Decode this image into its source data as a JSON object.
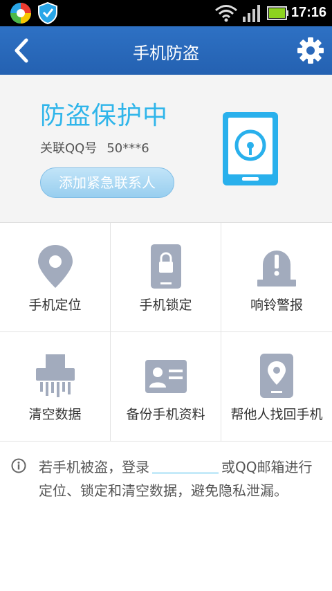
{
  "status_bar": {
    "time": "17:16",
    "icons": [
      "colorful-app-icon",
      "shield-app-icon",
      "wifi-icon",
      "signal-icon",
      "battery-icon"
    ],
    "battery_color": "#8dd21f"
  },
  "titlebar": {
    "title": "手机防盗",
    "back_icon": "back-arrow-icon",
    "settings_icon": "gear-icon",
    "color": "#2a68ba"
  },
  "hero": {
    "status_text": "防盗保护中",
    "qq_label": "关联QQ号",
    "qq_number": "50***6",
    "add_contact_button": "添加紧急联系人",
    "accent_color": "#2fb5ea"
  },
  "features": [
    {
      "label": "手机定位",
      "icon": "location-pin-icon"
    },
    {
      "label": "手机锁定",
      "icon": "phone-lock-icon"
    },
    {
      "label": "响铃警报",
      "icon": "alarm-bell-icon"
    },
    {
      "label": "清空数据",
      "icon": "shredder-icon"
    },
    {
      "label": "备份手机资料",
      "icon": "contact-card-icon"
    },
    {
      "label": "帮他人找回手机",
      "icon": "phone-location-icon"
    }
  ],
  "info": {
    "icon": "info-icon",
    "text_before_link": "若手机被盗，登录",
    "text_after_link": "或QQ邮箱进行定位、锁定和清空数据，避免隐私泄漏。"
  }
}
